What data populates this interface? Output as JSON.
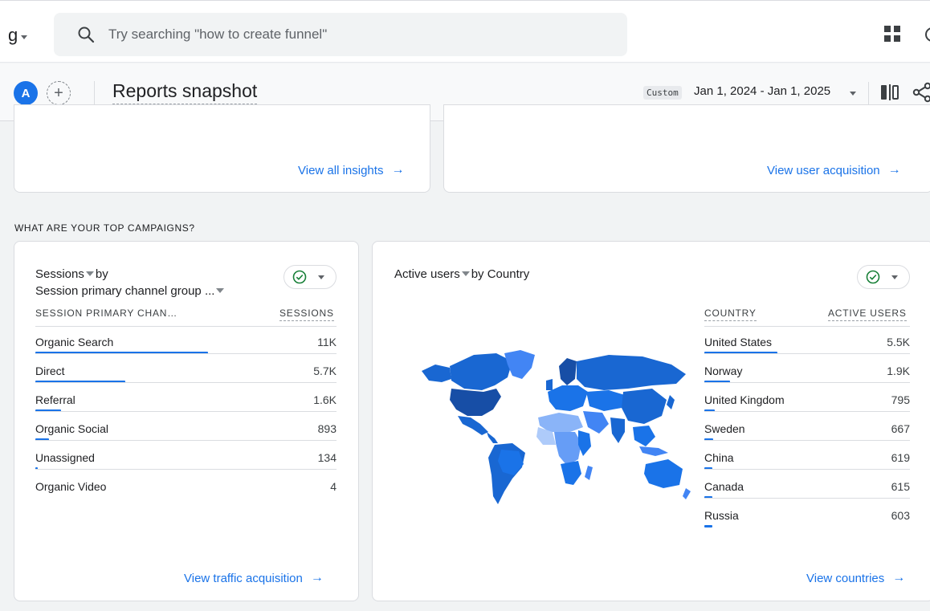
{
  "account": {
    "label": "g"
  },
  "search": {
    "placeholder": "Try searching \"how to create funnel\""
  },
  "header": {
    "avatar": "A",
    "add": "+",
    "title": "Reports snapshot",
    "custom_badge": "Custom",
    "date_range": "Jan 1, 2024 - Jan 1, 2025"
  },
  "top_cards": {
    "left_link": "View all insights",
    "right_link": "View user acquisition",
    "arrow": "→"
  },
  "section_label": "WHAT ARE YOUR TOP CAMPAIGNS?",
  "sessions_card": {
    "metric": "Sessions",
    "by": "by",
    "dimension": "Session primary channel group ...",
    "col_dimension": "SESSION PRIMARY CHAN…",
    "col_metric": "SESSIONS",
    "rows": [
      {
        "label": "Organic Search",
        "value": "11K",
        "share": 1.0
      },
      {
        "label": "Direct",
        "value": "5.7K",
        "share": 0.52
      },
      {
        "label": "Referral",
        "value": "1.6K",
        "share": 0.15
      },
      {
        "label": "Organic Social",
        "value": "893",
        "share": 0.08
      },
      {
        "label": "Unassigned",
        "value": "134",
        "share": 0.012
      },
      {
        "label": "Organic Video",
        "value": "4",
        "share": 0.0
      }
    ],
    "footer_link": "View traffic acquisition"
  },
  "users_card": {
    "metric": "Active users",
    "by_text": "by Country",
    "col_dimension": "COUNTRY",
    "col_metric": "ACTIVE USERS",
    "rows": [
      {
        "label": "United States",
        "value": "5.5K",
        "share": 1.0
      },
      {
        "label": "Norway",
        "value": "1.9K",
        "share": 0.35
      },
      {
        "label": "United Kingdom",
        "value": "795",
        "share": 0.145
      },
      {
        "label": "Sweden",
        "value": "667",
        "share": 0.12
      },
      {
        "label": "China",
        "value": "619",
        "share": 0.113
      },
      {
        "label": "Canada",
        "value": "615",
        "share": 0.112
      },
      {
        "label": "Russia",
        "value": "603",
        "share": 0.11
      }
    ],
    "footer_link": "View countries"
  },
  "colors": {
    "accent": "#1a73e8",
    "map_dark": "#174ea6",
    "map_mid": "#1967d2",
    "map_light": "#8ab4f8",
    "check": "#188038"
  }
}
